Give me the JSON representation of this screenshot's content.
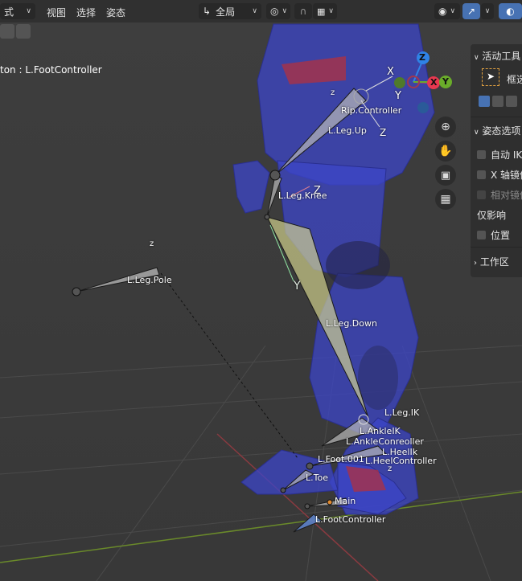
{
  "header": {
    "mode_label": "式",
    "menu_view": "视图",
    "menu_select": "选择",
    "menu_pose": "姿态",
    "transform_orientation": "全局"
  },
  "viewport": {
    "active_object_text": "ton : L.FootController"
  },
  "gizmo": {
    "x_label": "X",
    "y_label": "Y",
    "z_label": "Z"
  },
  "npanel": {
    "active_tool_header": "活动工具",
    "select_box_label": "框选",
    "pose_options_header": "姿态选项",
    "auto_ik_label": "自动 IK",
    "x_mirror_label": "X 轴镜像",
    "relative_mirror_label": "相对镜像",
    "affect_only_label": "仅影响",
    "location_label": "位置",
    "workspace_header": "工作区"
  },
  "bones": {
    "rip_controller": "Rip.Controller",
    "leg_up": "L.Leg.Up",
    "leg_knee": "L.Leg.Knee",
    "leg_pole": "L.Leg.Pole",
    "leg_down": "L.Leg.Down",
    "leg_ik": "L.Leg.IK",
    "ankle_ik": "L.AnkleIK",
    "ankle_controller": "L.AnkleConreoller",
    "heel_ik": "L.HeelIk",
    "foot_001": "L.Foot.001",
    "heel_controller": "L.HeelController",
    "toe": "L.Toe",
    "main": "Main",
    "foot_controller": "L.FootController"
  },
  "axis_letters": {
    "z_top": "z",
    "z_pole": "z",
    "y_up": "Y",
    "x_up": "X",
    "z_up": "Z",
    "z_knee": "Z",
    "y_down": "Y",
    "z_foot": "z"
  },
  "colors": {
    "header_bg": "#303030",
    "viewport_bg": "#3d3d3d",
    "mesh_blue": "#3c46c8",
    "bone_yellow": "#d8d890",
    "gizmo_x": "#e8384f",
    "gizmo_y": "#6aac2a",
    "gizmo_z": "#2f83e6",
    "accent_blue": "#4772b3"
  }
}
